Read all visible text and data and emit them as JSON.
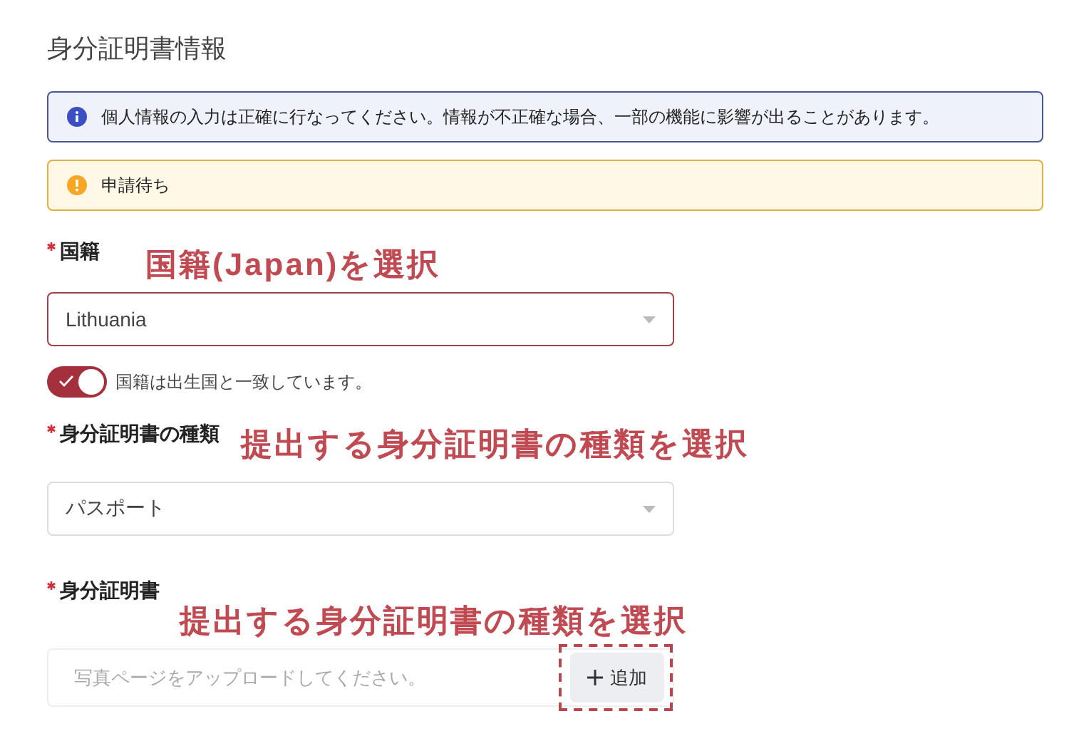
{
  "title": "身分証明書情報",
  "alerts": [
    {
      "kind": "info",
      "text": "個人情報の入力は正確に行なってください。情報が不正確な場合、一部の機能に影響が出ることがあります。"
    },
    {
      "kind": "warning",
      "text": "申請待ち"
    }
  ],
  "fields": [
    {
      "kind": "select",
      "required": true,
      "label": "国籍",
      "annotation": "国籍(Japan)を選択",
      "value": "Lithuania",
      "highlighted": true
    },
    {
      "kind": "toggle",
      "on": true,
      "label": "国籍は出生国と一致しています。"
    },
    {
      "kind": "select",
      "required": true,
      "label": "身分証明書の種類",
      "annotation": "提出する身分証明書の種類を選択",
      "value": "パスポート",
      "highlighted": false
    },
    {
      "kind": "upload",
      "required": true,
      "label": "身分証明書",
      "annotation": "提出する身分証明書の種類を選択",
      "placeholder": "写真ページをアップロードしてください。",
      "button": {
        "label": "追加",
        "highlighted": true
      }
    }
  ]
}
